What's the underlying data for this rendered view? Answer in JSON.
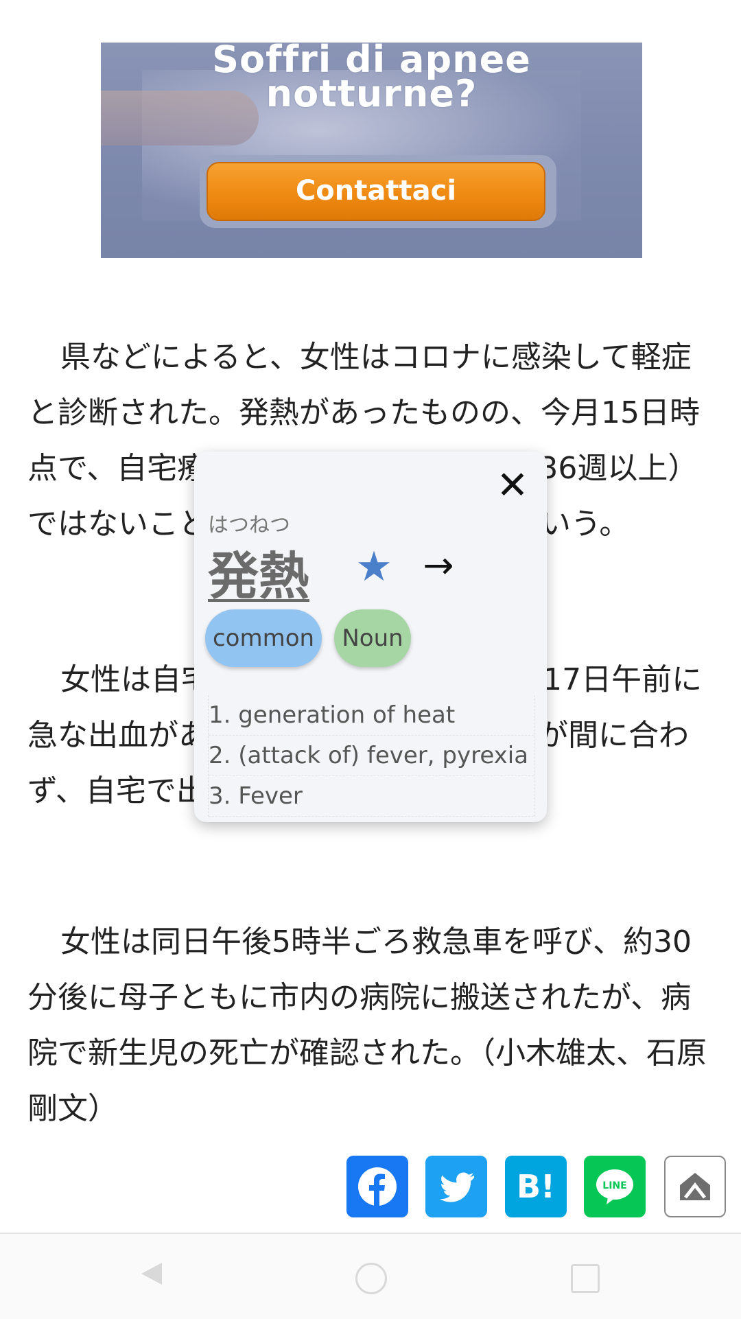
{
  "ad": {
    "headline": "Soffri di apnee notturne?",
    "button_label": "Contattaci"
  },
  "article": {
    "paragraphs": [
      "県などによると、女性はコロナに感染して軽症と診断された。発熱があったものの、今月15日時点で、自宅療養中に入院できる妊婦（36週以上）ではないことから入院が見送られたという。",
      "女性は自宅で療養を続けていたが、17日午前に急な出血があり、救急搬送が行われたが間に合わず、自宅で出産した。",
      "女性は同日午後5時半ごろ救急車を呼び、約30分後に母子ともに市内の病院に搬送されたが、病院で新生児の死亡が確認された。（小木雄太、石原剛文）"
    ]
  },
  "popup": {
    "reading": "はつねつ",
    "word": "発熱",
    "tags": [
      "common",
      "Noun"
    ],
    "definitions": [
      "1. generation of heat",
      "2. (attack of) fever, pyrexia",
      "3. Fever"
    ],
    "close_icon": "close-icon",
    "star_icon": "star-icon",
    "arrow_icon": "arrow-right-icon",
    "star_color": "#4a7fc9"
  },
  "share": {
    "hatena_label": "B!",
    "buttons": [
      "facebook-icon",
      "twitter-icon",
      "hatena-bookmark-icon",
      "line-icon",
      "pocket-icon"
    ],
    "colors": {
      "facebook": "#1877f2",
      "twitter": "#1da1f2",
      "hatena": "#00a4de",
      "line": "#06c755"
    }
  }
}
